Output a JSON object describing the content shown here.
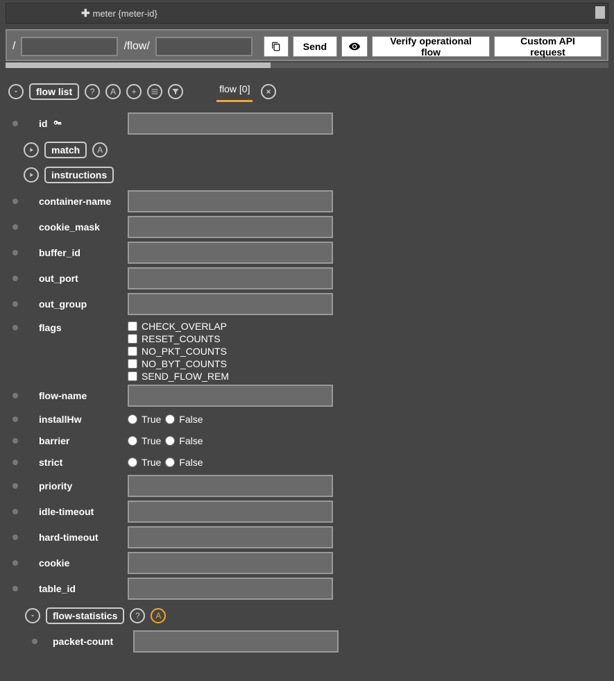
{
  "top": {
    "meter_label": "meter {meter-id}"
  },
  "path": {
    "segment1": "",
    "mid": "/flow/",
    "segment2": ""
  },
  "buttons": {
    "send": "Send",
    "verify": "Verify operational flow",
    "custom": "Custom API request"
  },
  "tree": {
    "flow_list": "flow list",
    "tab": "flow [0]"
  },
  "fields": {
    "id": {
      "label": "id",
      "value": ""
    },
    "match": {
      "label": "match"
    },
    "instructions": {
      "label": "instructions"
    },
    "container_name": {
      "label": "container-name",
      "value": ""
    },
    "cookie_mask": {
      "label": "cookie_mask",
      "value": ""
    },
    "buffer_id": {
      "label": "buffer_id",
      "value": ""
    },
    "out_port": {
      "label": "out_port",
      "value": ""
    },
    "out_group": {
      "label": "out_group",
      "value": ""
    },
    "flags": {
      "label": "flags",
      "options": [
        "CHECK_OVERLAP",
        "RESET_COUNTS",
        "NO_PKT_COUNTS",
        "NO_BYT_COUNTS",
        "SEND_FLOW_REM"
      ]
    },
    "flow_name": {
      "label": "flow-name",
      "value": ""
    },
    "installHw": {
      "label": "installHw",
      "true": "True",
      "false": "False"
    },
    "barrier": {
      "label": "barrier",
      "true": "True",
      "false": "False"
    },
    "strict": {
      "label": "strict",
      "true": "True",
      "false": "False"
    },
    "priority": {
      "label": "priority",
      "value": ""
    },
    "idle_timeout": {
      "label": "idle-timeout",
      "value": ""
    },
    "hard_timeout": {
      "label": "hard-timeout",
      "value": ""
    },
    "cookie": {
      "label": "cookie",
      "value": ""
    },
    "table_id": {
      "label": "table_id",
      "value": ""
    },
    "flow_statistics": {
      "label": "flow-statistics"
    },
    "packet_count": {
      "label": "packet-count",
      "value": ""
    }
  }
}
